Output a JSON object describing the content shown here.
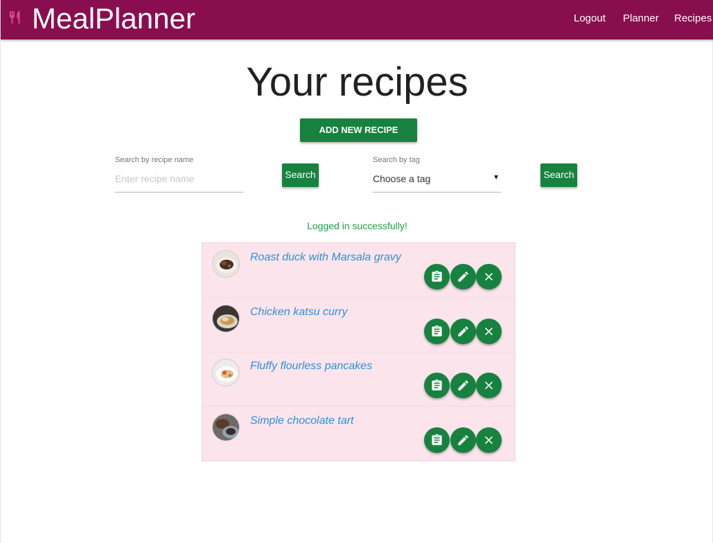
{
  "app": {
    "title": "MealPlanner",
    "brand_color": "#880e4f",
    "accent_green": "#17823f"
  },
  "nav": {
    "logout": "Logout",
    "planner": "Planner",
    "recipes": "Recipes"
  },
  "page": {
    "title": "Your recipes",
    "add_button": "ADD NEW RECIPE"
  },
  "search": {
    "name_label": "Search by recipe name",
    "name_placeholder": "Enter recipe name",
    "name_button": "Search",
    "tag_label": "Search by tag",
    "tag_value": "Choose a tag",
    "tag_button": "Search"
  },
  "status": "Logged in successfully!",
  "recipes": [
    {
      "name": "Roast duck with Marsala gravy"
    },
    {
      "name": "Chicken katsu curry"
    },
    {
      "name": "Fluffy flourless pancakes"
    },
    {
      "name": "Simple chocolate tart"
    }
  ],
  "icons": {
    "brand": "cutlery-icon",
    "view": "clipboard-icon",
    "edit": "pencil-icon",
    "delete": "close-icon"
  }
}
